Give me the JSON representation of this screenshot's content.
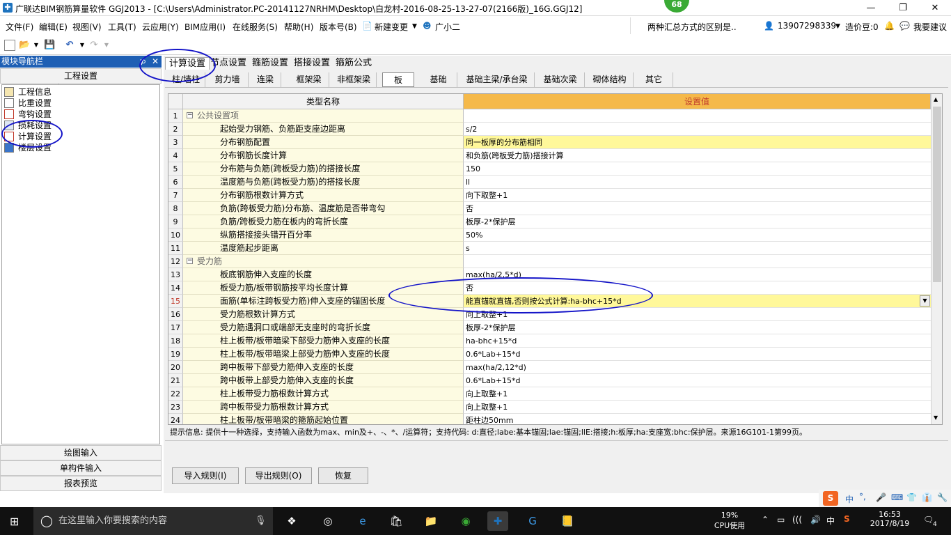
{
  "window": {
    "title": "广联达BIM钢筋算量软件 GGJ2013 - [C:\\Users\\Administrator.PC-20141127NRHM\\Desktop\\白龙村-2016-08-25-13-27-07(2166版)_16G.GGJ12]",
    "badge": "68"
  },
  "menubar": {
    "items": [
      "文件(F)",
      "编辑(E)",
      "视图(V)",
      "工具(T)",
      "云应用(Y)",
      "BIM应用(I)",
      "在线服务(S)",
      "帮助(H)",
      "版本号(B)",
      "新建变更",
      "广小二"
    ],
    "notice": "两种汇总方式的区别是..",
    "phone": "13907298339",
    "coin": "造价豆:0",
    "feedback": "我要建议"
  },
  "nav": {
    "title": "模块导航栏",
    "header": "工程设置",
    "items": [
      "工程信息",
      "比重设置",
      "弯钩设置",
      "损耗设置",
      "计算设置",
      "楼层设置"
    ],
    "bottom": [
      "绘图输入",
      "单构件输入",
      "报表预览"
    ]
  },
  "tabs": [
    "计算设置",
    "节点设置",
    "箍筋设置",
    "搭接设置",
    "箍筋公式"
  ],
  "subtabs": [
    "柱/墙柱",
    "剪力墙",
    "连梁",
    "框架梁",
    "非框架梁",
    "板",
    "基础",
    "基础主梁/承台梁",
    "基础次梁",
    "砌体结构",
    "其它"
  ],
  "grid": {
    "col_name": "类型名称",
    "col_value": "设置值",
    "rows": [
      {
        "n": "1",
        "name": "公共设置项",
        "value": ""
      },
      {
        "n": "2",
        "name": "起始受力钢筋、负筋距支座边距离",
        "value": "s/2"
      },
      {
        "n": "3",
        "name": "分布钢筋配置",
        "value": "同一板厚的分布筋相同"
      },
      {
        "n": "4",
        "name": "分布钢筋长度计算",
        "value": "和负筋(跨板受力筋)搭接计算"
      },
      {
        "n": "5",
        "name": "分布筋与负筋(跨板受力筋)的搭接长度",
        "value": "150"
      },
      {
        "n": "6",
        "name": "温度筋与负筋(跨板受力筋)的搭接长度",
        "value": "ll"
      },
      {
        "n": "7",
        "name": "分布钢筋根数计算方式",
        "value": "向下取整+1"
      },
      {
        "n": "8",
        "name": "负筋(跨板受力筋)分布筋、温度筋是否带弯勾",
        "value": "否"
      },
      {
        "n": "9",
        "name": "负筋/跨板受力筋在板内的弯折长度",
        "value": "板厚-2*保护层"
      },
      {
        "n": "10",
        "name": "纵筋搭接接头错开百分率",
        "value": "50%"
      },
      {
        "n": "11",
        "name": "温度筋起步距离",
        "value": "s"
      },
      {
        "n": "12",
        "name": "受力筋",
        "value": ""
      },
      {
        "n": "13",
        "name": "板底钢筋伸入支座的长度",
        "value": "max(ha/2,5*d)"
      },
      {
        "n": "14",
        "name": "板受力筋/板带钢筋按平均长度计算",
        "value": "否"
      },
      {
        "n": "15",
        "name": "面筋(单标注跨板受力筋)伸入支座的锚固长度",
        "value": "能直锚就直锚,否则按公式计算:ha-bhc+15*d"
      },
      {
        "n": "16",
        "name": "受力筋根数计算方式",
        "value": "向上取整+1"
      },
      {
        "n": "17",
        "name": "受力筋遇洞口或端部无支座时的弯折长度",
        "value": "板厚-2*保护层"
      },
      {
        "n": "18",
        "name": "柱上板带/板带暗梁下部受力筋伸入支座的长度",
        "value": "ha-bhc+15*d"
      },
      {
        "n": "19",
        "name": "柱上板带/板带暗梁上部受力筋伸入支座的长度",
        "value": "0.6*Lab+15*d"
      },
      {
        "n": "20",
        "name": "跨中板带下部受力筋伸入支座的长度",
        "value": "max(ha/2,12*d)"
      },
      {
        "n": "21",
        "name": "跨中板带上部受力筋伸入支座的长度",
        "value": "0.6*Lab+15*d"
      },
      {
        "n": "22",
        "name": "柱上板带受力筋根数计算方式",
        "value": "向上取整+1"
      },
      {
        "n": "23",
        "name": "跨中板带受力筋根数计算方式",
        "value": "向上取整+1"
      },
      {
        "n": "24",
        "name": "柱上板带/板带暗梁的箍筋起始位置",
        "value": "距柱边50mm"
      }
    ]
  },
  "hint": "提示信息: 提供十一种选择，支持输入函数为max、min及+、-、*、/运算符；支持代码: d:直径;labe:基本锚固;lae:锚固;llE:搭接;h:板厚;ha:支座宽;bhc:保护层。来源16G101-1第99页。",
  "buttons": [
    "导入规则(I)",
    "导出规则(O)",
    "恢复"
  ],
  "taskbar": {
    "search_placeholder": "在这里输入你要搜索的内容",
    "cpu_percent": "19%",
    "cpu_label": "CPU使用",
    "ime": "中",
    "time": "16:53",
    "date": "2017/8/19",
    "notifications": "4"
  },
  "sogou": {
    "lang": "中"
  }
}
